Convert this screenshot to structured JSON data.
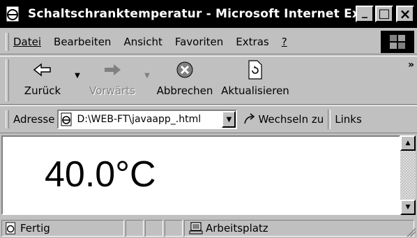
{
  "window": {
    "title": "Schaltschranktemperatur - Microsoft Internet Expl...",
    "controls": {
      "minimize": "_",
      "maximize": "□",
      "close": "×"
    }
  },
  "menu": {
    "items": [
      {
        "label": "Datei"
      },
      {
        "label": "Bearbeiten"
      },
      {
        "label": "Ansicht"
      },
      {
        "label": "Favoriten"
      },
      {
        "label": "Extras"
      },
      {
        "label": "?"
      }
    ]
  },
  "toolbar": {
    "back": {
      "label": "Zurück",
      "icon": "back-arrow-icon"
    },
    "forward": {
      "label": "Vorwärts",
      "icon": "forward-arrow-icon"
    },
    "stop": {
      "label": "Abbrechen",
      "icon": "stop-icon"
    },
    "refresh": {
      "label": "Aktualisieren",
      "icon": "refresh-icon"
    },
    "more": "»"
  },
  "address": {
    "label": "Adresse",
    "value": "D:\\WEB-FT\\javaapp_.html",
    "go_label": "Wechseln zu",
    "links_label": "Links"
  },
  "content": {
    "temperature": "40.0°C"
  },
  "status": {
    "text": "Fertig",
    "zone": "Arbeitsplatz"
  }
}
